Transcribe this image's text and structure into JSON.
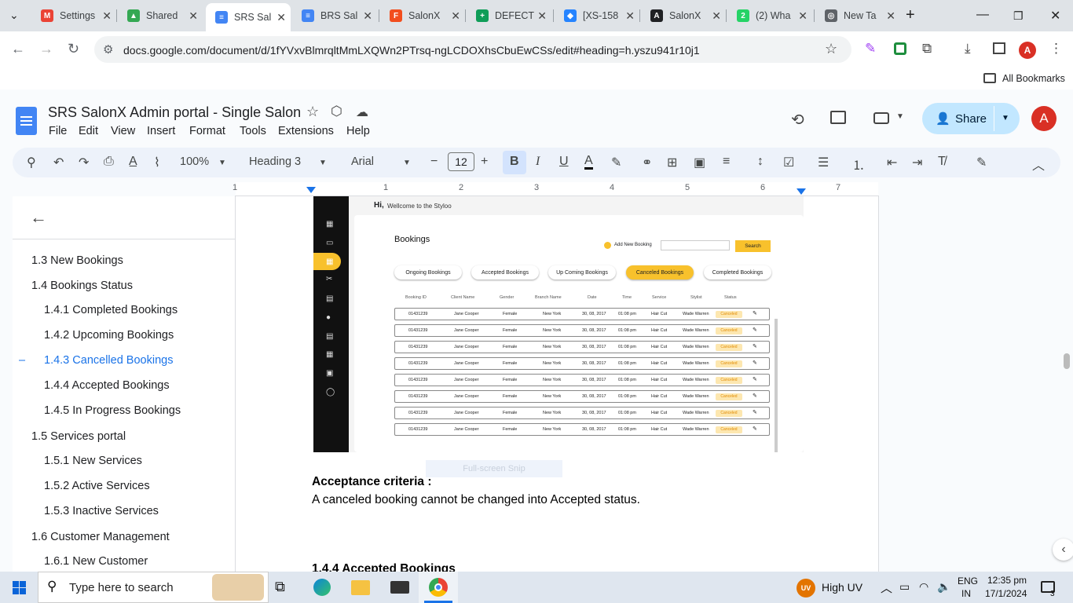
{
  "browser": {
    "tabs": [
      {
        "title": "Settings",
        "color": "#ea4335",
        "glyph": "M"
      },
      {
        "title": "Shared",
        "color": "#34a853",
        "glyph": "▲"
      },
      {
        "title": "SRS Sal",
        "color": "#4285f4",
        "glyph": "≡",
        "active": true
      },
      {
        "title": "BRS Sal",
        "color": "#4285f4",
        "glyph": "≡"
      },
      {
        "title": "SalonX",
        "color": "#f24e1e",
        "glyph": "F"
      },
      {
        "title": "DEFECT",
        "color": "#0f9d58",
        "glyph": "+"
      },
      {
        "title": "[XS-158",
        "color": "#2684ff",
        "glyph": "◆"
      },
      {
        "title": "SalonX",
        "color": "#202124",
        "glyph": "A"
      },
      {
        "title": "(2) Wha",
        "color": "#25d366",
        "glyph": "2"
      },
      {
        "title": "New Ta",
        "color": "#5f6368",
        "glyph": "◎"
      }
    ],
    "url": "docs.google.com/document/d/1fYVxvBlmrqltMmLXQWn2PTrsq-ngLCDOXhsCbuEwCSs/edit#heading=h.yszu941r10j1",
    "bookmarks_label": "All Bookmarks",
    "profile_initial": "A"
  },
  "doc": {
    "title": "SRS SalonX Admin portal - Single Salon",
    "menus": [
      "File",
      "Edit",
      "View",
      "Insert",
      "Format",
      "Tools",
      "Extensions",
      "Help"
    ],
    "share_label": "Share",
    "avatar_initial": "A",
    "zoom": "100%",
    "style": "Heading 3",
    "font": "Arial",
    "font_size": "12",
    "ruler_numbers": [
      "1",
      "1",
      "2",
      "3",
      "4",
      "5",
      "6",
      "7"
    ]
  },
  "outline": [
    {
      "label": "1.3 New Bookings",
      "level": 1
    },
    {
      "label": "1.4 Bookings Status",
      "level": 1
    },
    {
      "label": "1.4.1 Completed Bookings",
      "level": 2
    },
    {
      "label": "1.4.2 Upcoming Bookings",
      "level": 2
    },
    {
      "label": "1.4.3 Cancelled Bookings",
      "level": 2,
      "selected": true
    },
    {
      "label": "1.4.4 Accepted Bookings",
      "level": 2
    },
    {
      "label": "1.4.5 In Progress Bookings",
      "level": 2
    },
    {
      "label": "1.5 Services portal",
      "level": 1
    },
    {
      "label": "1.5.1 New Services",
      "level": 2
    },
    {
      "label": "1.5.2 Active Services",
      "level": 2
    },
    {
      "label": "1.5.3 Inactive Services",
      "level": 2
    },
    {
      "label": "1.6 Customer Management",
      "level": 1
    },
    {
      "label": "1.6.1 New Customer",
      "level": 2
    }
  ],
  "screenshot": {
    "greeting": "Hi,",
    "welcome": "Wellcome to the Styloo",
    "heading": "Bookings",
    "add_label": "Add New Booking",
    "search_label": "Search",
    "pills": [
      "Ongoing Bookings",
      "Accepted Bookings",
      "Up Coming Bookings",
      "Canceled Bookings",
      "Completed Bookings"
    ],
    "headers": [
      "Booking ID",
      "Client Name",
      "Gender",
      "Branch Name",
      "Date",
      "Time",
      "Service",
      "Stylist",
      "Status"
    ],
    "row": [
      "01431239",
      "Jane Cooper",
      "Female",
      "New York",
      "30, 08, 2017",
      "01:08 pm",
      "Hair Cut",
      "Wade Warren"
    ],
    "status": "Canceled",
    "accent": "#f8c12c",
    "snip_label": "Full-screen Snip"
  },
  "content": {
    "acceptance_title": "Acceptance criteria :",
    "acceptance_body": "A canceled booking cannot be changed into Accepted status.",
    "next_heading": "1.4.4  Accepted Bookings"
  },
  "taskbar": {
    "search_placeholder": "Type here to search",
    "weather": "High UV",
    "weather_badge": "UV",
    "lang1": "ENG",
    "lang2": "IN",
    "time": "12:35 pm",
    "date": "17/1/2024",
    "notifications": "3"
  }
}
